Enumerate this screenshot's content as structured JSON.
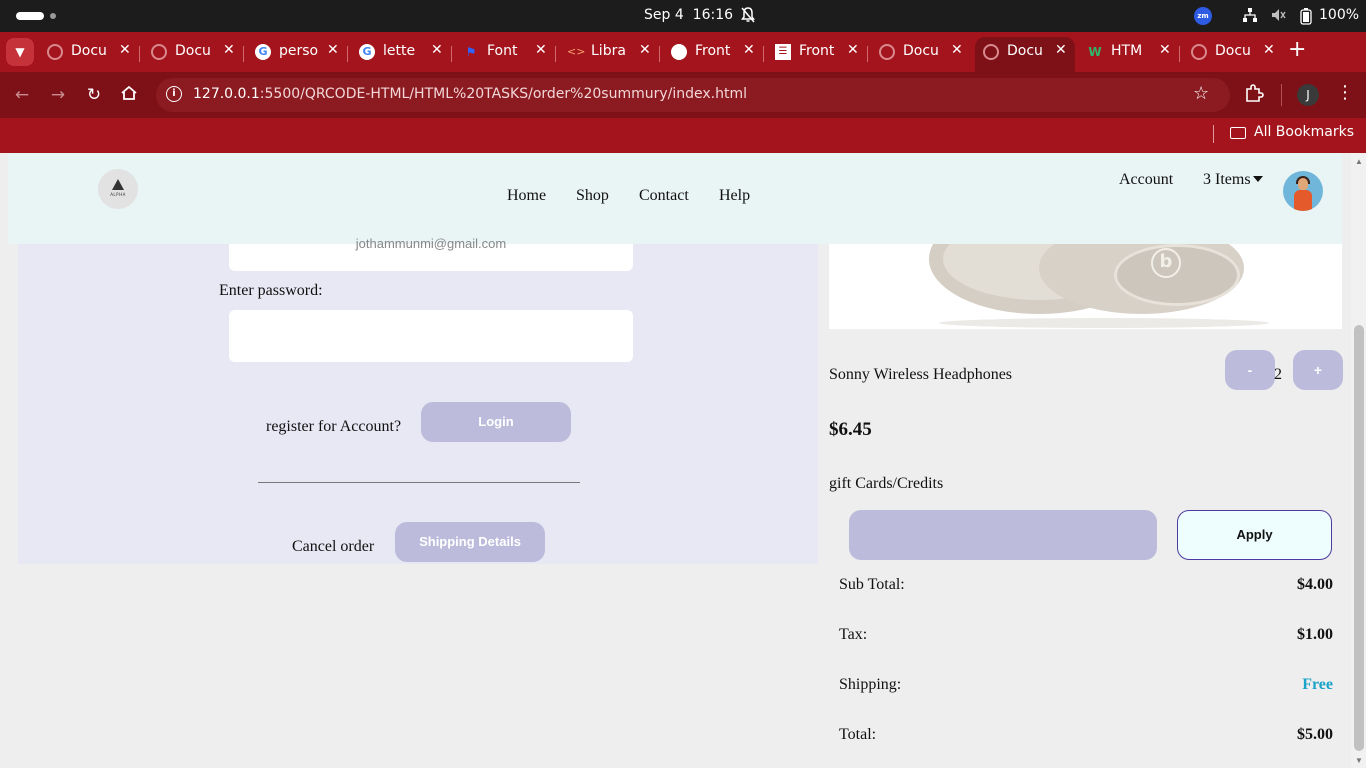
{
  "os": {
    "date": "Sep 4",
    "time": "16:16",
    "zoom_label": "zm",
    "battery": "100%"
  },
  "browser": {
    "tabs": [
      {
        "title": "Docu",
        "icon": "globe-icon",
        "active": false
      },
      {
        "title": "Docu",
        "icon": "globe-icon",
        "active": false
      },
      {
        "title": "perso",
        "icon": "google-icon",
        "active": false
      },
      {
        "title": "lette",
        "icon": "google-icon",
        "active": false
      },
      {
        "title": "Font",
        "icon": "flag-icon",
        "active": false
      },
      {
        "title": "Libra",
        "icon": "code-icon",
        "active": false
      },
      {
        "title": "Front",
        "icon": "frontend-mentor-icon",
        "active": false
      },
      {
        "title": "Front",
        "icon": "document-icon",
        "active": false
      },
      {
        "title": "Docu",
        "icon": "globe-icon",
        "active": false
      },
      {
        "title": "Docu",
        "icon": "globe-icon",
        "active": true
      },
      {
        "title": "HTM",
        "icon": "w3schools-icon",
        "active": false
      },
      {
        "title": "Docu",
        "icon": "globe-icon",
        "active": false
      }
    ],
    "url_host": "127.0.0.1",
    "url_path": ":5500/QRCODE-HTML/HTML%20TASKS/order%20summury/index.html",
    "profile_initial": "J",
    "bookmarks_label": "All Bookmarks",
    "accent_color": "#a3141c"
  },
  "site_nav": {
    "logo_text": "ALPHA",
    "links": [
      "Home",
      "Shop",
      "Contact",
      "Help"
    ],
    "account": "Account",
    "items": "3 Items"
  },
  "form": {
    "email_value": "jothammunmi@gmail.com",
    "password_label": "Enter password:",
    "password_value": "",
    "register_text": "register for Account?",
    "login_button": "Login",
    "cancel_text": "Cancel order",
    "shipping_button": "Shipping Details"
  },
  "summary": {
    "product_name": "Sonny Wireless Headphones",
    "qty_minus": "-",
    "qty_plus": "+",
    "quantity": "2",
    "price": "$6.45",
    "gift_label": "gift Cards/Credits",
    "gift_value": "",
    "apply_button": "Apply",
    "lines": [
      {
        "label": "Sub Total:",
        "value": "$4.00"
      },
      {
        "label": "Tax:",
        "value": "$1.00"
      },
      {
        "label": "Shipping:",
        "value": "Free"
      },
      {
        "label": "Total:",
        "value": "$5.00"
      }
    ],
    "free_color": "#1aa3c9",
    "button_color": "#bcbbdc"
  }
}
